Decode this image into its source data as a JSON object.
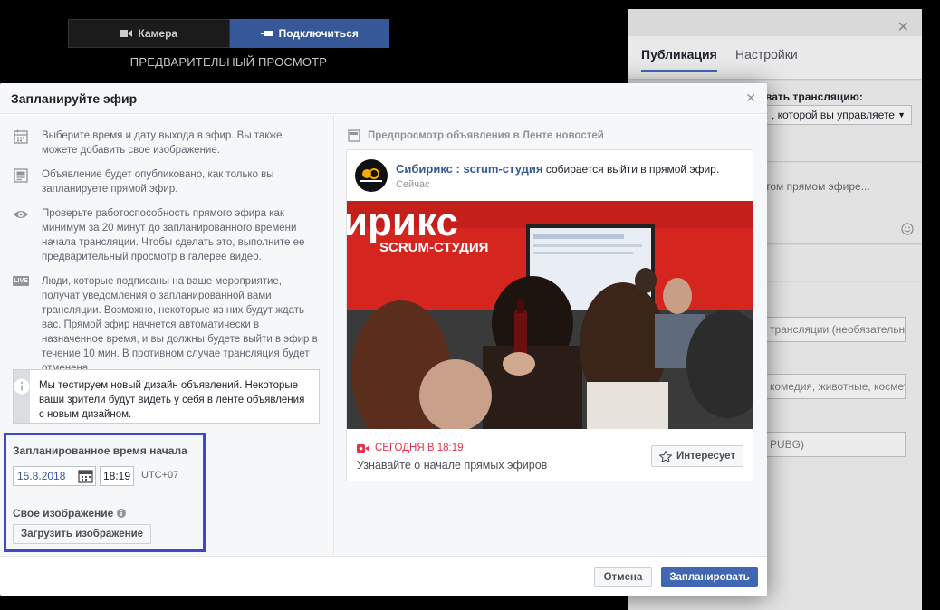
{
  "live_preview": {
    "camera_label": "Камера",
    "connect_label": "Подключиться",
    "preview_title": "ПРЕДВАРИТЕЛЬНЫЙ ПРОСМОТР"
  },
  "right_panel": {
    "tabs": [
      {
        "label": "Публикация",
        "active": true
      },
      {
        "label": "Настройки",
        "active": false
      }
    ],
    "share_label": "вать трансляцию:",
    "page_select": ", которой вы управляете",
    "post_placeholder": "том прямом эфире...",
    "title_placeholder": " трансляции (необязательно",
    "tags_placeholder": "комедия, животные, косметика",
    "game_placeholder": "PUBG)"
  },
  "modal": {
    "title": "Запланируйте эфир",
    "info": [
      {
        "icon": "calendar-icon",
        "text": "Выберите время и дату выхода в эфир. Вы также можете добавить свое изображение."
      },
      {
        "icon": "post-icon",
        "text": "Объявление будет опубликовано, как только вы запланируете прямой эфир."
      },
      {
        "icon": "eye-icon",
        "text": "Проверьте работоспособность прямого эфира как минимум за 20 минут до запланированного времени начала трансляции. Чтобы сделать это, выполните ее предварительный просмотр в галерее видео."
      },
      {
        "icon": "live-icon",
        "text": "Люди, которые подписаны на ваше мероприятие, получат уведомления о запланированной вами трансляции. Возможно, некоторые из них будут ждать вас. Прямой эфир начнется автоматически в назначенное время, и вы должны будете выйти в эфир в течение 10 мин. В противном случае трансляция будет отменена."
      }
    ],
    "live_badge": "LIVE",
    "notice": "Мы тестируем новый дизайн объявлений. Некоторые ваши зрители будут видеть у себя в ленте объявления с новым дизайном.",
    "start_time_label": "Запланированное время начала",
    "date_value": "15.8.2018",
    "time_value": "18:19",
    "timezone": "UTC+07",
    "image_label": "Свое изображение",
    "upload_label": "Загрузить изображение",
    "cancel_label": "Отмена",
    "schedule_label": "Запланировать"
  },
  "preview": {
    "label": "Предпросмотр объявления в Ленте новостей",
    "page_name": "Сибирикс : scrum-студия",
    "action_text": "собирается выйти в прямой эфир.",
    "time": "Сейчас",
    "banner_text": "ирикс",
    "banner_sub": "SCRUM-СТУДИЯ",
    "event_date": "СЕГОДНЯ В 18:19",
    "event_desc": "Узнавайте о начале прямых эфиров",
    "interested_label": "Интересует"
  },
  "colors": {
    "accent": "#4267b2",
    "link": "#365899",
    "live_red": "#e9304b",
    "highlight": "#3f48cc"
  }
}
